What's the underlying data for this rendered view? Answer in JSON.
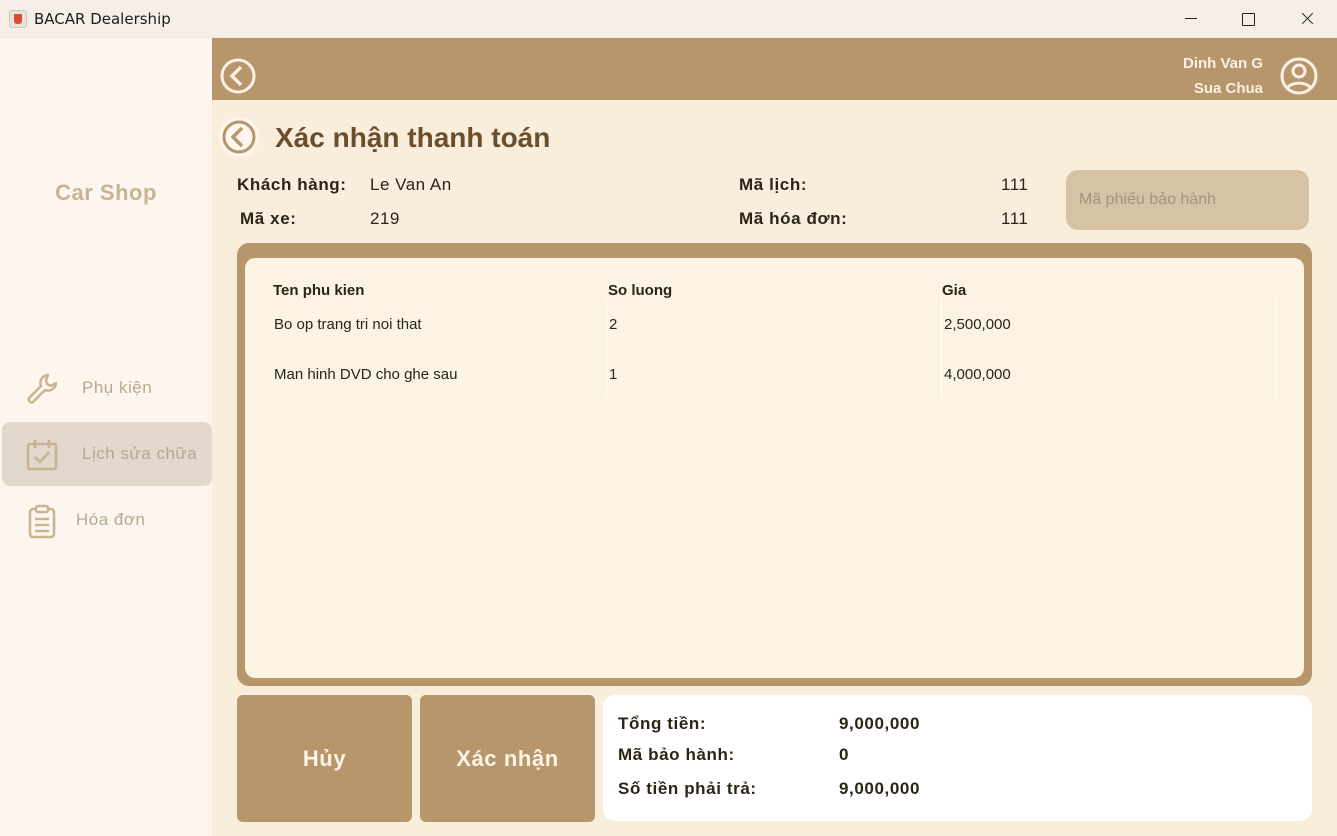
{
  "window": {
    "title": "BACAR Dealership"
  },
  "sidebar": {
    "brand": "Car Shop",
    "items": [
      {
        "label": "Phụ kiện",
        "icon": "wrench-icon",
        "active": false
      },
      {
        "label": "Lịch sửa chữa",
        "icon": "calendar-check-icon",
        "active": true
      },
      {
        "label": "Hóa đơn",
        "icon": "clipboard-icon",
        "active": false
      }
    ]
  },
  "header": {
    "user_name": "Dinh Van G",
    "user_role": "Sua Chua"
  },
  "page": {
    "title": "Xác nhận thanh toán",
    "info": {
      "customer_label": "Khách hàng:",
      "customer_value": "Le Van An",
      "car_label": "Mã xe:",
      "car_value": "219",
      "schedule_label": "Mã lịch:",
      "schedule_value": "111",
      "invoice_label": "Mã hóa đơn:",
      "invoice_value": "111"
    },
    "warranty_placeholder": "Mã phiếu bảo hành"
  },
  "table": {
    "headers": [
      "Ten phu kien",
      "So luong",
      "Gia"
    ],
    "rows": [
      [
        "Bo op trang tri noi that",
        "2",
        "2,500,000"
      ],
      [
        "Man hinh DVD cho ghe sau",
        "1",
        "4,000,000"
      ]
    ]
  },
  "actions": {
    "cancel_label": "Hủy",
    "confirm_label": "Xác nhận"
  },
  "summary": {
    "total_label": "Tổng tiền:",
    "total_value": "9,000,000",
    "warranty_label": "Mã bảo hành:",
    "warranty_value": "0",
    "pay_label": "Số tiền phải trả:",
    "pay_value": "9,000,000"
  },
  "colors": {
    "accent": "#b7966b",
    "background": "#f9eddb",
    "sidebar": "#fdf6ef",
    "active_item": "#e2d8cd"
  }
}
